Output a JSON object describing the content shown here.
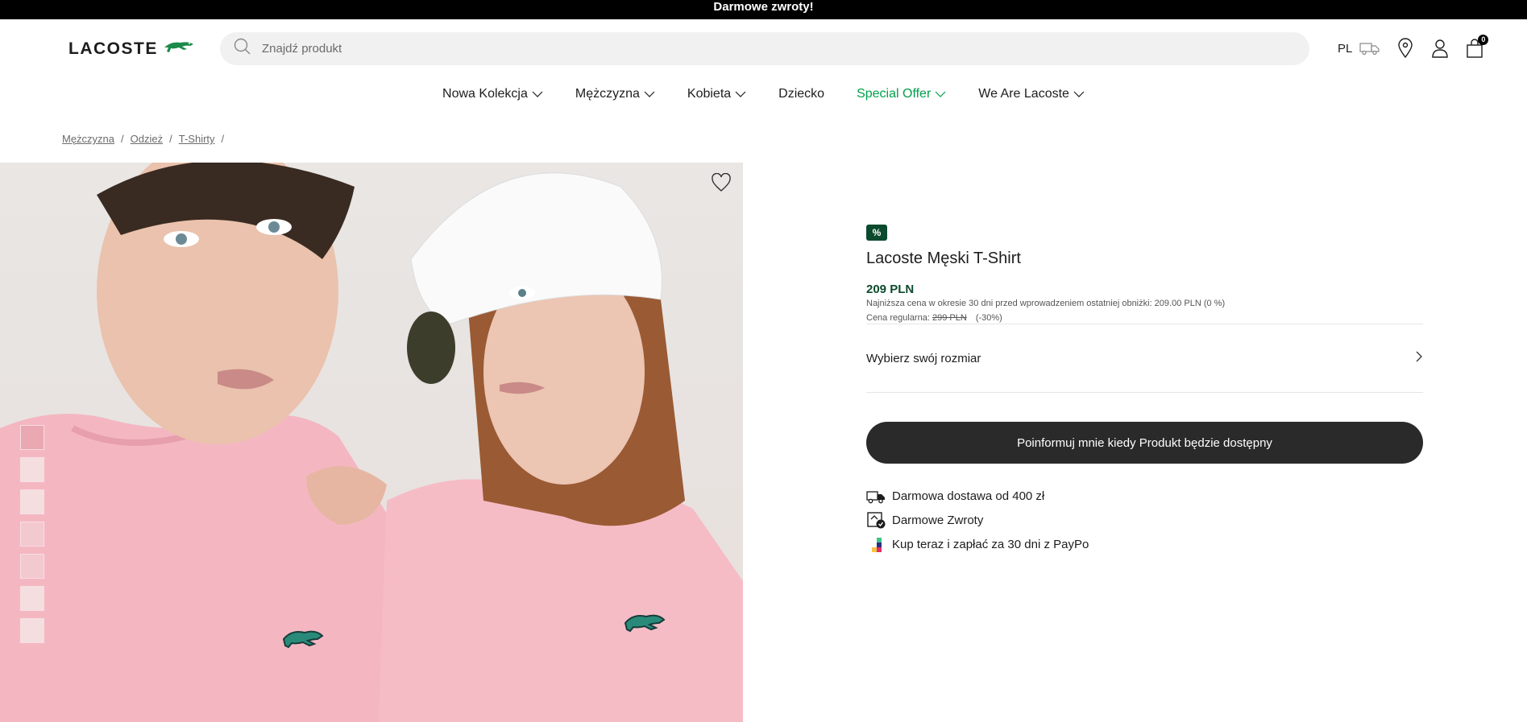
{
  "promo": {
    "text": "Darmowe zwroty!"
  },
  "header": {
    "logo_text": "LACOSTE",
    "search_placeholder": "Znajdź produkt",
    "language": "PL",
    "cart_count": "0"
  },
  "nav": {
    "items": [
      {
        "label": "Nowa Kolekcja",
        "has_dropdown": true
      },
      {
        "label": "Mężczyzna",
        "has_dropdown": true
      },
      {
        "label": "Kobieta",
        "has_dropdown": true
      },
      {
        "label": "Dziecko",
        "has_dropdown": false
      },
      {
        "label": "Special Offer",
        "has_dropdown": true,
        "color": "#00a04a"
      },
      {
        "label": "We Are Lacoste",
        "has_dropdown": true
      }
    ]
  },
  "breadcrumb": [
    {
      "label": "Mężczyzna"
    },
    {
      "label": "Odzież"
    },
    {
      "label": "T-Shirty"
    }
  ],
  "breadcrumb_sep": "/",
  "product": {
    "badge": "%",
    "title": "Lacoste Męski T-Shirt",
    "price": "209 PLN",
    "lowest_price_note": "Najniższa cena w okresie 30 dni przed wprowadzeniem ostatniej obniżki: 209.00 PLN (0 %)",
    "regular_label": "Cena regularna:",
    "regular_price": "299 PLN",
    "discount": "(-30%)",
    "size_label": "Wybierz swój rozmiar",
    "notify_button": "Poinformuj mnie kiedy Produkt będzie dostępny",
    "perks": [
      {
        "icon": "delivery-truck-icon",
        "label": "Darmowa dostawa od 400 zł"
      },
      {
        "icon": "free-returns-icon",
        "label": "Darmowe Zwroty"
      },
      {
        "icon": "paypo-icon",
        "label": "Kup teraz i zapłać za 30 dni z PayPo"
      }
    ]
  },
  "colors": {
    "promo_bg": "#000000",
    "accent_green": "#00a04a",
    "badge_green": "#0c4a2d",
    "button_dark": "#2a2a2a",
    "shirt_pink": "#f2b9c2"
  }
}
